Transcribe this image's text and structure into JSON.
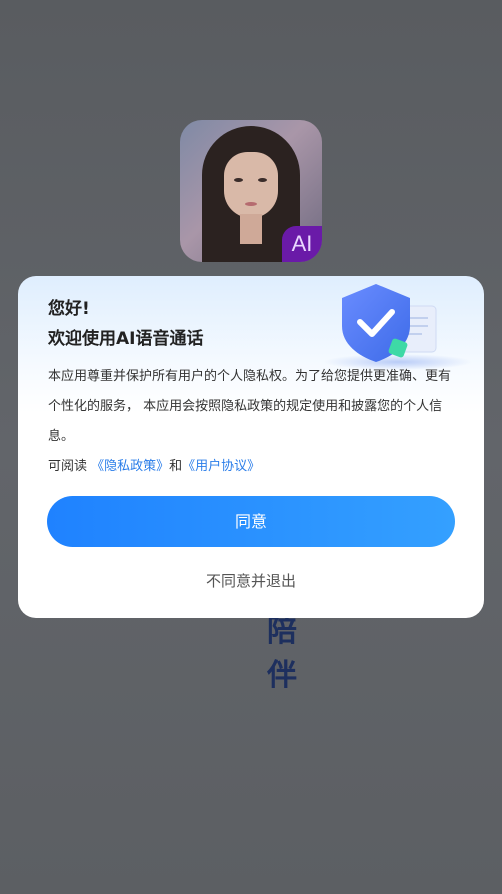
{
  "app": {
    "logo_badge": "AI",
    "vertical_text": [
      "陪",
      "伴"
    ]
  },
  "dialog": {
    "greeting": "您好!",
    "welcome": "欢迎使用AI语音通话",
    "body": "本应用尊重并保护所有用户的个人隐私权。为了给您提供更准确、更有个性化的服务， 本应用会按照隐私政策的规定使用和披露您的个人信息。",
    "read_prefix": "可阅读 ",
    "privacy_link": "《隐私政策》",
    "and": "和",
    "terms_link": "《用户协议》",
    "agree_label": "同意",
    "decline_label": "不同意并退出"
  },
  "colors": {
    "accent": "#1f82ff",
    "link": "#2a7de9",
    "overlay": "#5f6266"
  },
  "icons": {
    "illustration": "shield-check-icon"
  }
}
